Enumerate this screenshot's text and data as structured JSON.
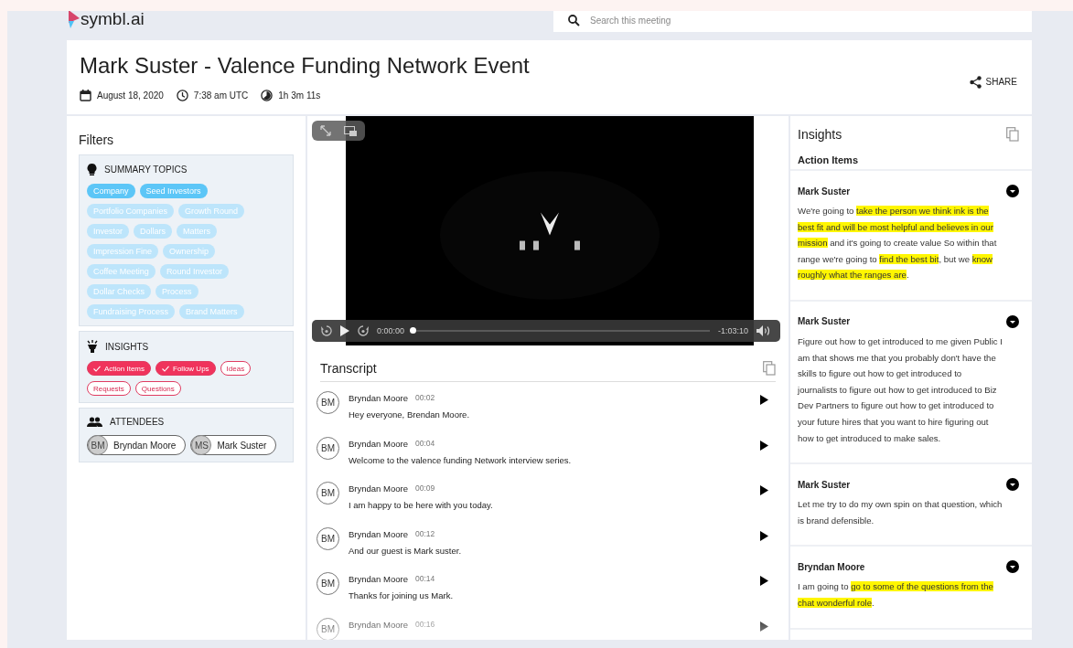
{
  "header": {
    "logo": "symbl.ai",
    "search": {
      "placeholder": "Search this meeting"
    }
  },
  "meeting": {
    "title": "Mark Suster - Valence Funding Network Event",
    "date": "August 18, 2020",
    "time": "7:38 am UTC",
    "duration": "1h 3m 11s",
    "share": "SHARE"
  },
  "filters": {
    "title": "Filters",
    "summary_topics": {
      "heading": "SUMMARY TOPICS",
      "topics": [
        {
          "label": "Company",
          "selected": true
        },
        {
          "label": "Seed Investors",
          "selected": true
        },
        {
          "label": "Portfolio Companies",
          "selected": false
        },
        {
          "label": "Growth Round",
          "selected": false
        },
        {
          "label": "Investor",
          "selected": false
        },
        {
          "label": "Dollars",
          "selected": false
        },
        {
          "label": "Matters",
          "selected": false
        },
        {
          "label": "Impression Fine",
          "selected": false
        },
        {
          "label": "Ownership",
          "selected": false
        },
        {
          "label": "Coffee Meeting",
          "selected": false
        },
        {
          "label": "Round Investor",
          "selected": false
        },
        {
          "label": "Dollar Checks",
          "selected": false
        },
        {
          "label": "Process",
          "selected": false
        },
        {
          "label": "Fundraising Process",
          "selected": false
        },
        {
          "label": "Brand Matters",
          "selected": false
        }
      ]
    },
    "insights": {
      "heading": "INSIGHTS",
      "types": [
        {
          "label": "Action Items",
          "selected": true
        },
        {
          "label": "Follow Ups",
          "selected": true
        },
        {
          "label": "Ideas",
          "selected": false
        },
        {
          "label": "Requests",
          "selected": false
        },
        {
          "label": "Questions",
          "selected": false
        }
      ]
    },
    "attendees": {
      "heading": "ATTENDEES",
      "people": [
        {
          "initials": "BM",
          "name": "Bryndan Moore"
        },
        {
          "initials": "MS",
          "name": "Mark Suster"
        }
      ]
    }
  },
  "player": {
    "elapsed": "0:00:00",
    "remaining": "-1:03:10",
    "level": 0
  },
  "transcript": {
    "title": "Transcript",
    "entries": [
      {
        "initials": "BM",
        "speaker": "Bryndan Moore",
        "time": "00:02",
        "text": "Hey everyone, Brendan Moore."
      },
      {
        "initials": "BM",
        "speaker": "Bryndan Moore",
        "time": "00:04",
        "text": "Welcome to the valence funding Network interview series."
      },
      {
        "initials": "BM",
        "speaker": "Bryndan Moore",
        "time": "00:09",
        "text": "I am happy to be here with you today."
      },
      {
        "initials": "BM",
        "speaker": "Bryndan Moore",
        "time": "00:12",
        "text": "And our guest is Mark suster."
      },
      {
        "initials": "BM",
        "speaker": "Bryndan Moore",
        "time": "00:14",
        "text": "Thanks for joining us Mark."
      },
      {
        "initials": "BM",
        "speaker": "Bryndan Moore",
        "time": "00:16"
      }
    ]
  },
  "insights": {
    "title": "Insights",
    "section": "Action Items",
    "items": [
      {
        "speaker": "Mark Suster",
        "segments": [
          {
            "text": "We're going to ",
            "highlighted": false
          },
          {
            "text": "take the person we think ink is the best fit and will be most helpful and believes in our mission",
            "highlighted": true
          },
          {
            "text": " and it's going to create value So within that range we're going to ",
            "highlighted": false
          },
          {
            "text": "find the best bit",
            "highlighted": true
          },
          {
            "text": ", but we ",
            "highlighted": false
          },
          {
            "text": "know roughly what the ranges are",
            "highlighted": true
          },
          {
            "text": ".",
            "highlighted": false
          }
        ]
      },
      {
        "speaker": "Mark Suster",
        "segments": [
          {
            "text": "Figure out how to get introduced to me given Public I am that shows me that you probably don't have the skills to figure out how to get introduced to journalists to figure out how to get introduced to Biz Dev Partners to figure out how to get introduced to your future hires that you want to hire figuring out how to get introduced to make sales.",
            "highlighted": false
          }
        ]
      },
      {
        "speaker": "Mark Suster",
        "segments": [
          {
            "text": "Let me try to do my own spin on that question, which is brand defensible.",
            "highlighted": false
          }
        ]
      },
      {
        "speaker": "Bryndan Moore",
        "segments": [
          {
            "text": "I am going to ",
            "highlighted": false
          },
          {
            "text": "go to some of the questions from the chat wonderful role",
            "highlighted": true
          },
          {
            "text": ".",
            "highlighted": false
          }
        ]
      }
    ]
  }
}
